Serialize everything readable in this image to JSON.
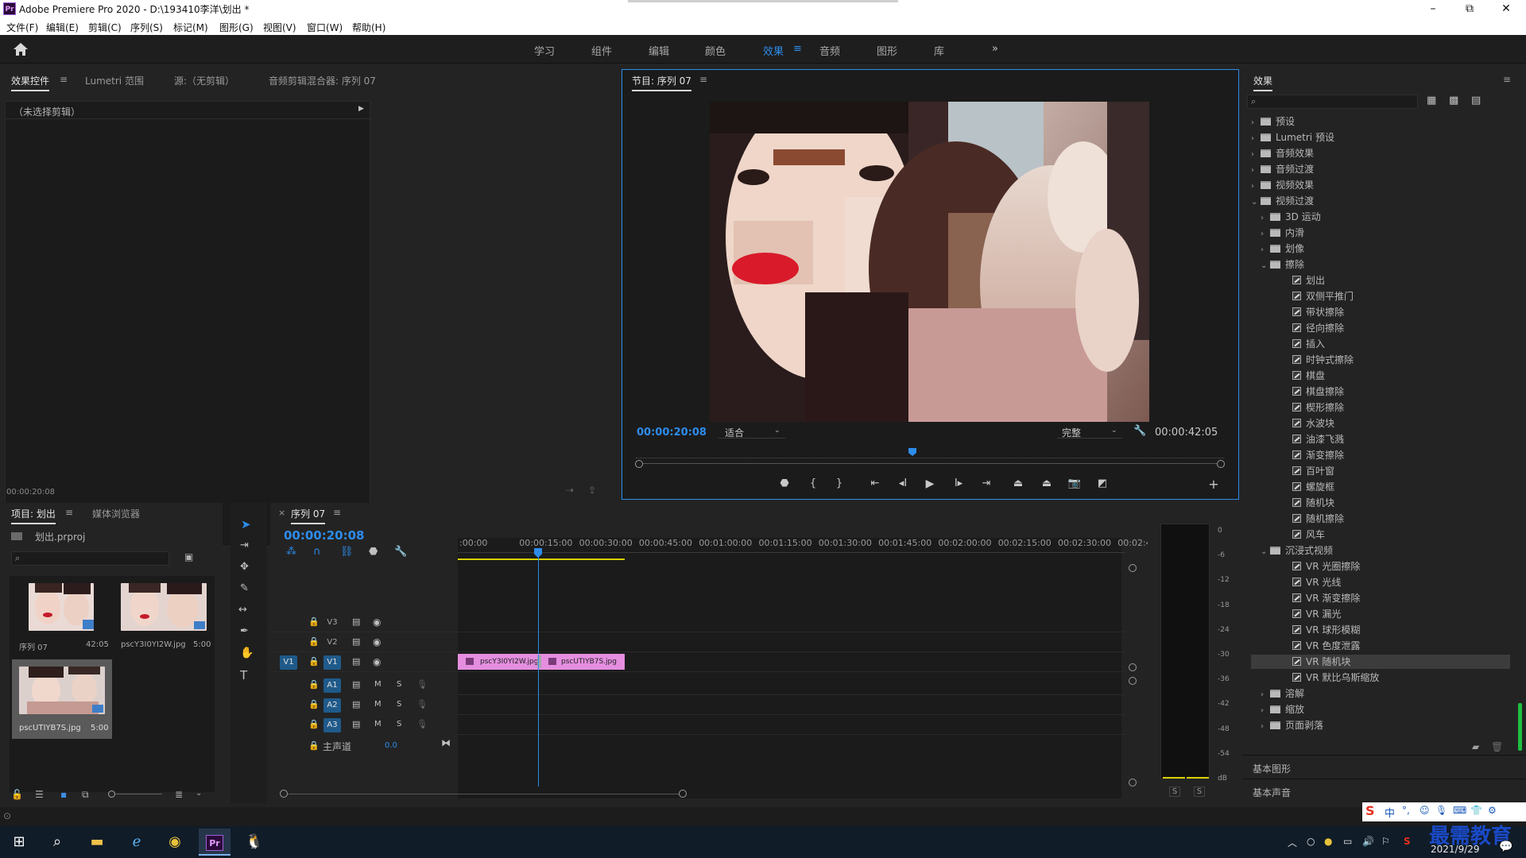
{
  "window": {
    "title": "Adobe Premiere Pro 2020 - D:\\193410李洋\\划出 *",
    "logo": "Pr",
    "minimize": "–",
    "maximize": "⧉",
    "close": "✕"
  },
  "menu": [
    "文件(F)",
    "编辑(E)",
    "剪辑(C)",
    "序列(S)",
    "标记(M)",
    "图形(G)",
    "视图(V)",
    "窗口(W)",
    "帮助(H)"
  ],
  "workspaces": {
    "items": [
      "学习",
      "组件",
      "编辑",
      "颜色",
      "效果",
      "音频",
      "图形",
      "库"
    ],
    "active": "效果",
    "more": "»"
  },
  "source_panel": {
    "tabs": [
      "效果控件",
      "Lumetri 范围",
      "源:（无剪辑）",
      "音频剪辑混合器: 序列 07"
    ],
    "no_clip": "（未选择剪辑）",
    "timecode": "00:00:20:08"
  },
  "program_monitor": {
    "title": "节目: 序列 07",
    "current_time": "00:00:20:08",
    "fit": "适合",
    "quality": "完整",
    "duration": "00:00:42:05",
    "playhead_fraction": 0.47
  },
  "effects_panel": {
    "title": "效果",
    "tree": [
      {
        "label": "预设",
        "level": 0,
        "kind": "folder",
        "open": false
      },
      {
        "label": "Lumetri 预设",
        "level": 0,
        "kind": "folder",
        "open": false
      },
      {
        "label": "音频效果",
        "level": 0,
        "kind": "folder",
        "open": false
      },
      {
        "label": "音频过渡",
        "level": 0,
        "kind": "folder",
        "open": false
      },
      {
        "label": "视频效果",
        "level": 0,
        "kind": "folder",
        "open": false
      },
      {
        "label": "视频过渡",
        "level": 0,
        "kind": "folder",
        "open": true
      },
      {
        "label": "3D 运动",
        "level": 1,
        "kind": "folder",
        "open": false
      },
      {
        "label": "内滑",
        "level": 1,
        "kind": "folder",
        "open": false
      },
      {
        "label": "划像",
        "level": 1,
        "kind": "folder",
        "open": false
      },
      {
        "label": "擦除",
        "level": 1,
        "kind": "folder",
        "open": true
      },
      {
        "label": "划出",
        "level": 2,
        "kind": "fx"
      },
      {
        "label": "双侧平推门",
        "level": 2,
        "kind": "fx"
      },
      {
        "label": "带状擦除",
        "level": 2,
        "kind": "fx"
      },
      {
        "label": "径向擦除",
        "level": 2,
        "kind": "fx"
      },
      {
        "label": "插入",
        "level": 2,
        "kind": "fx"
      },
      {
        "label": "时钟式擦除",
        "level": 2,
        "kind": "fx"
      },
      {
        "label": "棋盘",
        "level": 2,
        "kind": "fx"
      },
      {
        "label": "棋盘擦除",
        "level": 2,
        "kind": "fx"
      },
      {
        "label": "楔形擦除",
        "level": 2,
        "kind": "fx"
      },
      {
        "label": "水波块",
        "level": 2,
        "kind": "fx"
      },
      {
        "label": "油漆飞溅",
        "level": 2,
        "kind": "fx"
      },
      {
        "label": "渐变擦除",
        "level": 2,
        "kind": "fx"
      },
      {
        "label": "百叶窗",
        "level": 2,
        "kind": "fx"
      },
      {
        "label": "螺旋框",
        "level": 2,
        "kind": "fx"
      },
      {
        "label": "随机块",
        "level": 2,
        "kind": "fx"
      },
      {
        "label": "随机擦除",
        "level": 2,
        "kind": "fx"
      },
      {
        "label": "风车",
        "level": 2,
        "kind": "fx"
      },
      {
        "label": "沉浸式视频",
        "level": 1,
        "kind": "folder",
        "open": true
      },
      {
        "label": "VR 光圈擦除",
        "level": 2,
        "kind": "fx"
      },
      {
        "label": "VR 光线",
        "level": 2,
        "kind": "fx"
      },
      {
        "label": "VR 渐变擦除",
        "level": 2,
        "kind": "fx"
      },
      {
        "label": "VR 漏光",
        "level": 2,
        "kind": "fx"
      },
      {
        "label": "VR 球形模糊",
        "level": 2,
        "kind": "fx"
      },
      {
        "label": "VR 色度泄露",
        "level": 2,
        "kind": "fx"
      },
      {
        "label": "VR 随机块",
        "level": 2,
        "kind": "fx",
        "selected": true
      },
      {
        "label": "VR 默比乌斯缩放",
        "level": 2,
        "kind": "fx"
      },
      {
        "label": "溶解",
        "level": 1,
        "kind": "folder",
        "open": false
      },
      {
        "label": "缩放",
        "level": 1,
        "kind": "folder",
        "open": false
      },
      {
        "label": "页面剥落",
        "level": 1,
        "kind": "folder",
        "open": false
      }
    ],
    "basic_graphics": "基本图形",
    "basic_sound": "基本声音"
  },
  "project_panel": {
    "tabs": [
      "项目: 划出",
      "媒体浏览器"
    ],
    "project_file": "划出.prproj",
    "items": [
      {
        "name": "序列 07",
        "duration": "42:05"
      },
      {
        "name": "pscY3I0YI2W.jpg",
        "duration": "5:00"
      },
      {
        "name": "pscUTIYB7S.jpg",
        "duration": "5:00"
      }
    ]
  },
  "timeline": {
    "tab": "序列 07",
    "timecode": "00:00:20:08",
    "ruler": [
      ":00:00",
      "00:00:15:00",
      "00:00:30:00",
      "00:00:45:00",
      "00:01:00:00",
      "00:01:15:00",
      "00:01:30:00",
      "00:01:45:00",
      "00:02:00:00",
      "00:02:15:00",
      "00:02:30:00",
      "00:02:45:"
    ],
    "video_tracks": [
      "V3",
      "V2",
      "V1"
    ],
    "audio_tracks": [
      "A1",
      "A2",
      "A3"
    ],
    "source_patch": "V1",
    "mute": "M",
    "solo": "S",
    "master": "主声道",
    "master_value": "0.0",
    "clips": [
      {
        "name": "pscY3I0YI2W.jpg"
      },
      {
        "name": "pscUTIYB7S.jpg"
      }
    ]
  },
  "audio_meter": {
    "scale": [
      "0",
      "-6",
      "-12",
      "-18",
      "-24",
      "-30",
      "-36",
      "-42",
      "-48",
      "-54",
      "dB"
    ],
    "solo_left": "S",
    "solo_right": "S"
  },
  "taskbar": {
    "ime": "中",
    "date": "2021/9/29",
    "watermark": "最需教育"
  }
}
